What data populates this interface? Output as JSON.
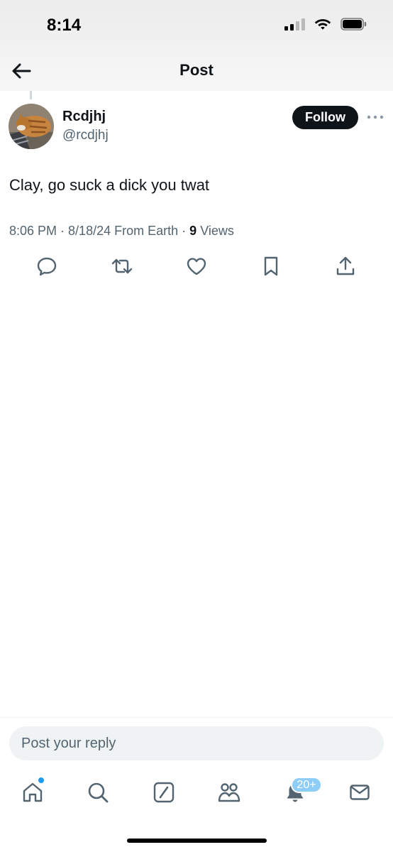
{
  "status_bar": {
    "time": "8:14"
  },
  "header": {
    "title": "Post",
    "back_icon": "arrow-left-icon"
  },
  "post": {
    "author": {
      "display_name": "Rcdjhj",
      "handle": "@rcdjhj"
    },
    "follow_label": "Follow",
    "text": "Clay, go suck a dick you twat",
    "meta": {
      "time": "8:06 PM",
      "date": "8/18/24",
      "source": "From Earth",
      "views_count": "9",
      "views_label": "Views"
    }
  },
  "actions": [
    "reply-icon",
    "repost-icon",
    "like-icon",
    "bookmark-icon",
    "share-icon"
  ],
  "reply": {
    "placeholder": "Post your reply"
  },
  "tab_bar": {
    "tabs": [
      "home-icon",
      "search-icon",
      "grok-icon",
      "communities-icon",
      "notifications-icon",
      "messages-icon"
    ],
    "notifications_badge": "20+"
  },
  "colors": {
    "text": "#0f1419",
    "secondary": "#536471",
    "accent": "#1d9bf0",
    "badge": "#8ecdf8",
    "follow_bg": "#0f1419"
  }
}
